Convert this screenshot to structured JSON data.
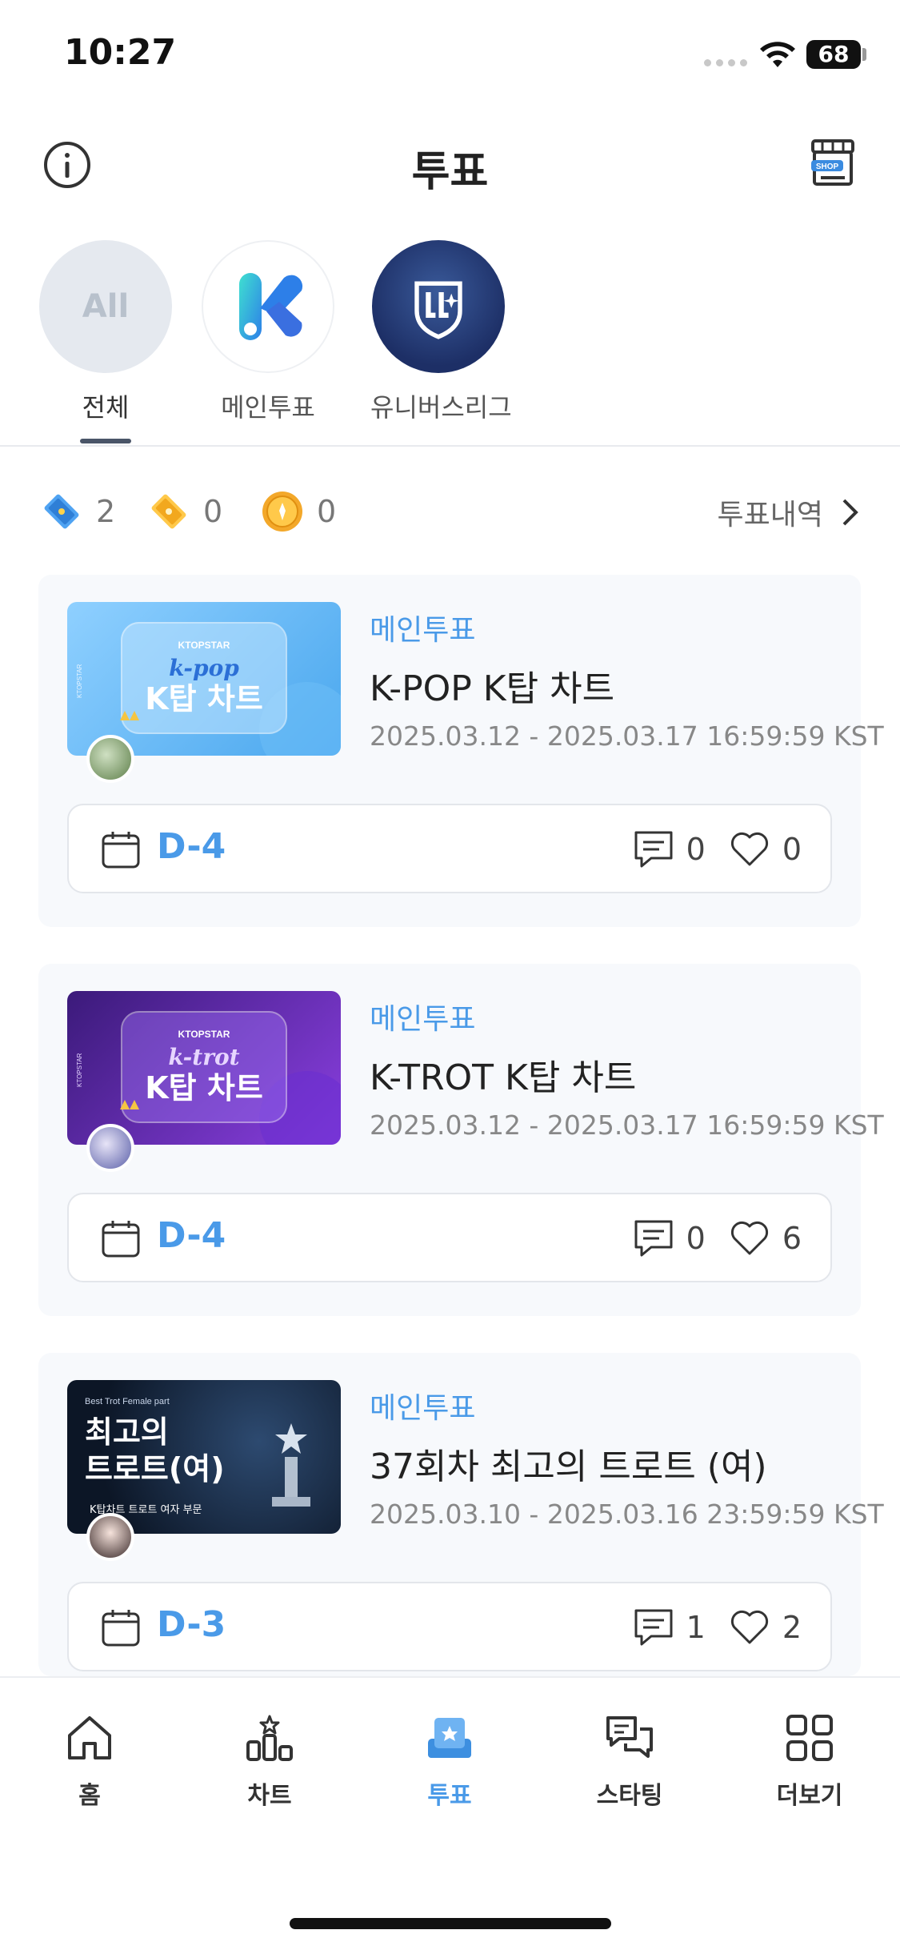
{
  "status_bar": {
    "time": "10:27",
    "battery": "68"
  },
  "header": {
    "title": "투표",
    "shop_badge": "SHOP"
  },
  "categories": [
    {
      "label": "전체",
      "icon_text": "All",
      "active": true
    },
    {
      "label": "메인투표",
      "active": false
    },
    {
      "label": "유니버스리그",
      "active": false
    }
  ],
  "tickets": [
    {
      "icon": "blue-ticket-icon",
      "count": "2"
    },
    {
      "icon": "gold-ticket-icon",
      "count": "0"
    },
    {
      "icon": "coin-icon",
      "count": "0"
    }
  ],
  "vote_history_label": "투표내역",
  "cards": [
    {
      "category": "메인투표",
      "title": "K-POP K탑 차트",
      "date": "2025.03.12 - 2025.03.17 16:59:59 KST",
      "dday": "D-4",
      "comments": "0",
      "likes": "0",
      "thumb": {
        "brand": "KTOPSTAR",
        "script": "k-pop",
        "headline": "K탑 차트",
        "side": "KTOPSTAR"
      }
    },
    {
      "category": "메인투표",
      "title": "K-TROT K탑 차트",
      "date": "2025.03.12 - 2025.03.17 16:59:59 KST",
      "dday": "D-4",
      "comments": "0",
      "likes": "6",
      "thumb": {
        "brand": "KTOPSTAR",
        "script": "k-trot",
        "headline": "K탑 차트",
        "side": "KTOPSTAR"
      }
    },
    {
      "category": "메인투표",
      "title": "37회차 최고의 트로트 (여)",
      "date": "2025.03.10 - 2025.03.16 23:59:59 KST",
      "dday": "D-3",
      "comments": "1",
      "likes": "2",
      "thumb": {
        "top": "Best Trot Female part",
        "line1": "최고의",
        "line2": "트로트(여)",
        "sub": "K탑차트 트로트 여자 부문"
      }
    }
  ],
  "nav": [
    {
      "label": "홈",
      "icon": "home-icon",
      "active": false
    },
    {
      "label": "차트",
      "icon": "chart-icon",
      "active": false
    },
    {
      "label": "투표",
      "icon": "vote-icon",
      "active": true
    },
    {
      "label": "스타팅",
      "icon": "chat-icon",
      "active": false
    },
    {
      "label": "더보기",
      "icon": "grid-icon",
      "active": false
    }
  ],
  "colors": {
    "accent": "#4a9ae8",
    "card_bg": "#f7f9fc",
    "text": "#222222"
  }
}
